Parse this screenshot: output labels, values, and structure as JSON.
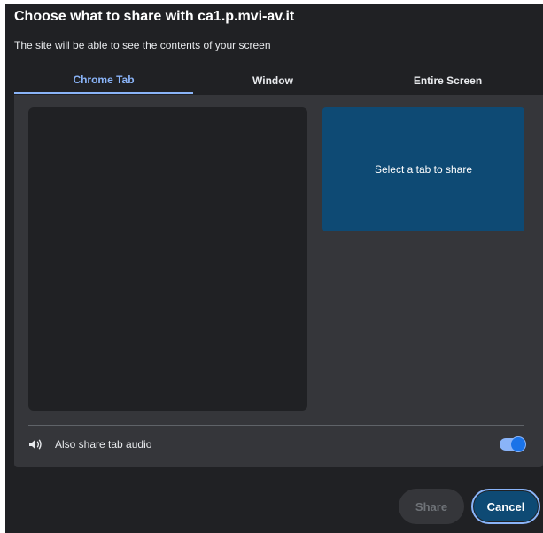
{
  "dialog": {
    "title": "Choose what to share with ca1.p.mvi-av.it",
    "subtitle": "The site will be able to see the contents of your screen"
  },
  "tabs": [
    {
      "label": "Chrome Tab",
      "active": true
    },
    {
      "label": "Window",
      "active": false
    },
    {
      "label": "Entire Screen",
      "active": false
    }
  ],
  "tab_list": {
    "selected_item_label": "Select a tab to share"
  },
  "audio": {
    "label": "Also share tab audio",
    "icon": "speaker-icon",
    "enabled": true
  },
  "buttons": {
    "share_label": "Share",
    "cancel_label": "Cancel"
  },
  "colors": {
    "dialog_background": "#202124",
    "panel_background": "#35363a",
    "accent": "#8ab4f8",
    "selected_item": "#0e4a74"
  }
}
